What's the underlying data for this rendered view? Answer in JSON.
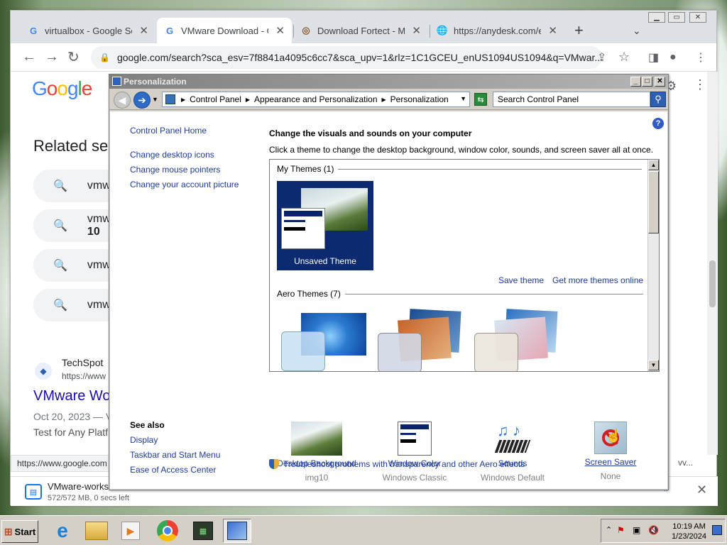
{
  "chrome": {
    "tabs": [
      {
        "title": "virtualbox - Google Sea",
        "icon": "google-g-icon"
      },
      {
        "title": "VMware Download - Go",
        "icon": "google-g-icon",
        "active": true
      },
      {
        "title": "Download Fortect - Maj",
        "icon": "fortect-icon"
      },
      {
        "title": "https://anydesk.com/en",
        "icon": "globe-icon"
      }
    ],
    "url": "google.com/search?sca_esv=7f8841a4095c6cc7&sca_upv=1&rlz=1C1GCEU_enUS1094US1094&q=VMwar...",
    "status_url": "https://www.google.com"
  },
  "google": {
    "logo": "Google",
    "related_heading": "Related sea",
    "related_items": [
      "vmw",
      "vmw",
      "vmw",
      "vmw"
    ],
    "related_item2_line2": "10",
    "result": {
      "site": "TechSpot",
      "url": "https://www",
      "title": "VMware Wo",
      "date": "Oct 20, 2023 — V",
      "snippet": "Test for Any Platf"
    },
    "download": {
      "name": "VMware-works",
      "progress": "572/572 MB, 0 secs left",
      "button_fragment": "ll"
    },
    "bottom_fragment": "vv..."
  },
  "personalization": {
    "window_title": "Personalization",
    "breadcrumbs": [
      "Control Panel",
      "Appearance and Personalization",
      "Personalization"
    ],
    "search_placeholder": "Search Control Panel",
    "sidebar": [
      "Control Panel Home",
      "Change desktop icons",
      "Change mouse pointers",
      "Change your account picture"
    ],
    "see_also_heading": "See also",
    "see_also": [
      "Display",
      "Taskbar and Start Menu",
      "Ease of Access Center"
    ],
    "heading": "Change the visuals and sounds on your computer",
    "subheading": "Click a theme to change the desktop background, window color, sounds, and screen saver all at once.",
    "my_themes": "My Themes (1)",
    "unsaved_theme": "Unsaved Theme",
    "save_theme": "Save theme",
    "get_more": "Get more themes online",
    "aero_themes": "Aero Themes (7)",
    "bottom": [
      {
        "label": "Desktop Background",
        "sub": "img10"
      },
      {
        "label": "Window Color",
        "sub": "Windows Classic"
      },
      {
        "label": "Sounds",
        "sub": "Windows Default"
      },
      {
        "label": "Screen Saver",
        "sub": "None"
      }
    ],
    "troubleshoot": "Troubleshoot problems with transparency and other Aero effects"
  },
  "taskbar": {
    "start": "Start",
    "time": "10:19 AM",
    "date": "1/23/2024"
  }
}
